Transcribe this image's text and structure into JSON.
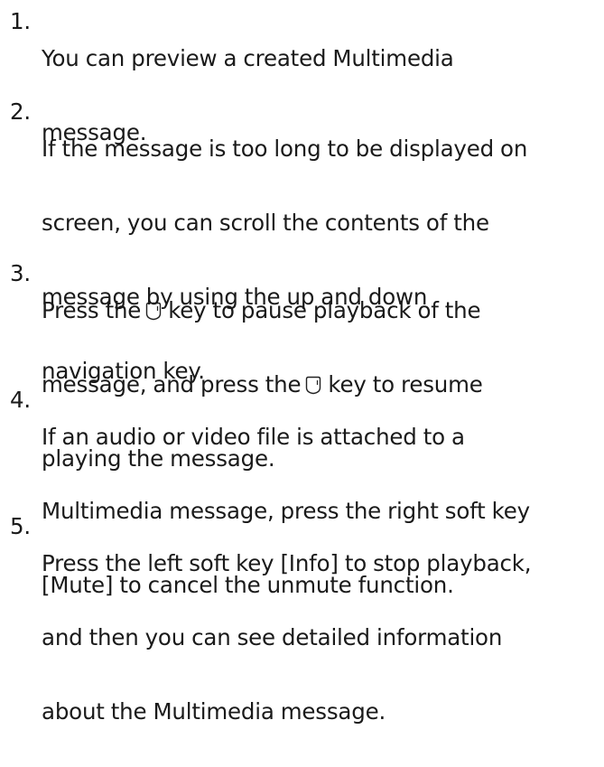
{
  "steps": [
    {
      "number": "1.",
      "lines": [
        "You can preview a created Multimedia",
        "message."
      ]
    },
    {
      "number": "2.",
      "lines": [
        "If the message is too long to be displayed on",
        "screen, you can scroll the contents of the",
        "message by using the up and down",
        "navigation key."
      ]
    },
    {
      "number": "3.",
      "line1_before": "Press the",
      "line1_after": "key to pause playback of the",
      "line2_before": "message, and press the",
      "line2_after": "key to resume",
      "line3": "playing the message.",
      "key_icon": "soft-key-icon"
    },
    {
      "number": "4.",
      "lines": [
        "If an audio or video file is attached to a",
        "Multimedia message, press the right soft key",
        "[Mute] to cancel the unmute function."
      ]
    },
    {
      "number": "5.",
      "lines": [
        "Press the left soft key [Info] to stop playback,",
        "and then you can see detailed information",
        "about the Multimedia message."
      ]
    }
  ]
}
